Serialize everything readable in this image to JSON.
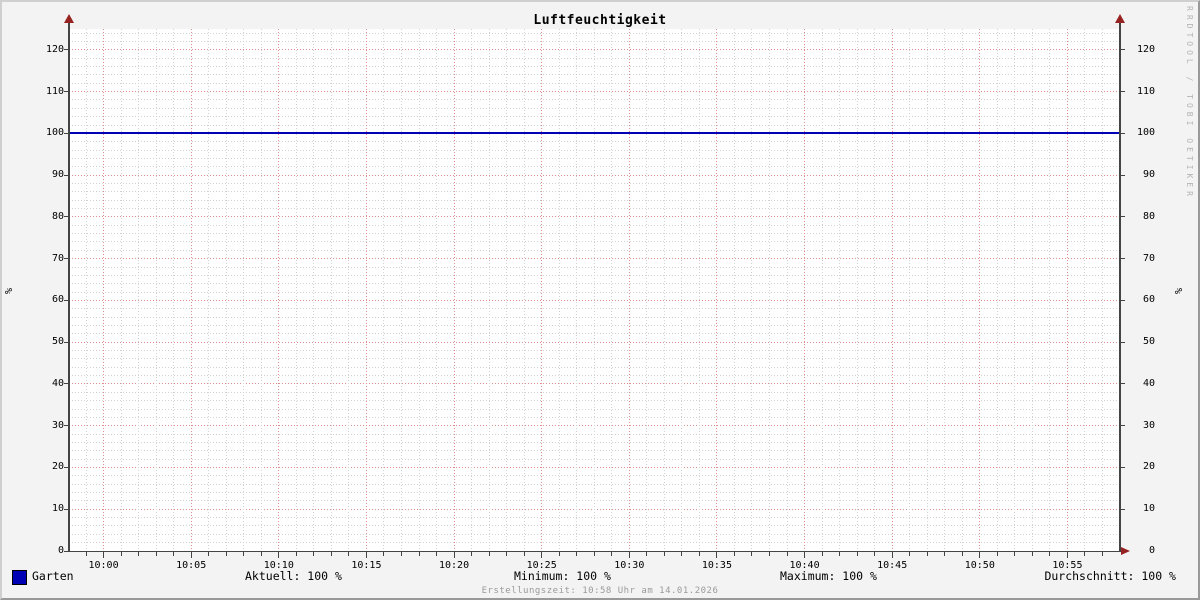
{
  "title": "Luftfeuchtigkeit",
  "y_axis_label_left": "%",
  "y_axis_label_right": "%",
  "watermark": "RRDTOOL / TOBI OETIKER",
  "footer": "Erstellungszeit: 10:58 Uhr am 14.01.2026",
  "legend": {
    "series_label": "Garten",
    "stats": [
      {
        "name": "aktuell",
        "text": "Aktuell: 100 %"
      },
      {
        "name": "minimum",
        "text": "Minimum: 100 %"
      },
      {
        "name": "maximum",
        "text": "Maximum: 100 %"
      },
      {
        "name": "durchschnitt",
        "text": "Durchschnitt: 100 %"
      }
    ]
  },
  "colors": {
    "background": "#F3F3F3",
    "canvas": "#FFFFFF",
    "border_light": "#CFCFCF",
    "border_dark": "#999999",
    "axis": "#444444",
    "arrow": "#962222",
    "grid_major": "#E08F8F",
    "grid_minor": "#D2D2D2",
    "series": "#0000B4",
    "footer_text": "#9A9A9A",
    "watermark_text": "#B4B4B4"
  },
  "chart_data": {
    "type": "line",
    "title": "Luftfeuchtigkeit",
    "xlabel": "",
    "ylabel": "%",
    "ylim": [
      0,
      125
    ],
    "x_range": [
      "09:58",
      "10:58"
    ],
    "x_total_minutes": 60,
    "x_first_tick_minute": 2,
    "x_tick_step_minutes": 5,
    "x_minor_step_minutes": 1,
    "x_ticks": [
      "10:00",
      "10:05",
      "10:10",
      "10:15",
      "10:20",
      "10:25",
      "10:30",
      "10:35",
      "10:40",
      "10:45",
      "10:50",
      "10:55"
    ],
    "y_ticks": [
      0,
      10,
      20,
      30,
      40,
      50,
      60,
      70,
      80,
      90,
      100,
      110,
      120
    ],
    "y_minor_step": 2,
    "grid": true,
    "legend_position": "bottom",
    "series": [
      {
        "name": "Garten",
        "color": "#0000B4",
        "shape": "constant",
        "value": 100,
        "stats": {
          "aktuell": "100 %",
          "minimum": "100 %",
          "maximum": "100 %",
          "durchschnitt": "100 %"
        }
      }
    ]
  }
}
